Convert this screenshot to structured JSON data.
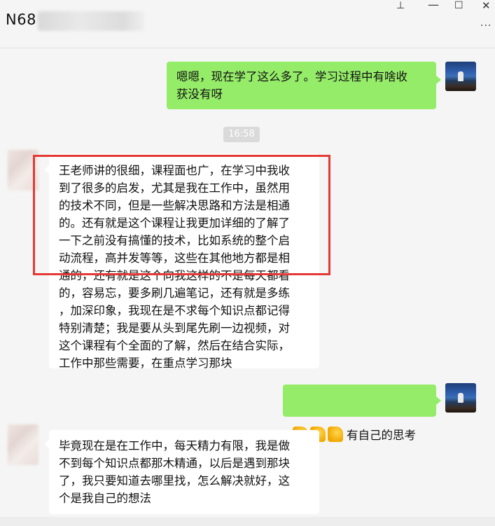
{
  "header": {
    "title": "N68",
    "pin_icon": "pin-icon",
    "minimize_icon": "minimize-icon",
    "maximize_icon": "maximize-icon",
    "close_icon": "close-icon",
    "more_icon": "more-icon"
  },
  "glyphs": {
    "pin": "⊥",
    "minimize": "—",
    "maximize": "☐",
    "close": "✕",
    "more": "···"
  },
  "messages": [
    {
      "sender": "me",
      "text": "嗯嗯，现在学了这么多了。学习过程中有啥收\n获没有呀"
    },
    {
      "sender": "system",
      "text": "16:58"
    },
    {
      "sender": "other",
      "text": "王老师讲的很细，课程面也广，在学习中我收\n到了很多的启发，尤其是我在工作中，虽然用\n的技术不同，但是一些解决思路和方法是相通\n的。还有就是这个课程让我更加详细的了解了\n一下之前没有搞懂的技术，比如系统的整个启\n动流程，高并发等等，这些在其他地方都是相\n通的，还有就是这个向我这样的不是每天都看\n的，容易忘，要多刷几遍笔记，还有就是多练\n，加深印象，我现在是不求每个知识点都记得\n特别清楚；我是要从头到尾先刷一边视频，对\n这个课程有个全面的了解，然后在结合实际，\n工作中那些需要，在重点学习那块"
    },
    {
      "sender": "me",
      "emoji": "thumbs-up-icon",
      "emoji_count": 3,
      "text": "有自己的思考"
    },
    {
      "sender": "other",
      "text": "毕竟现在是在工作中，每天精力有限，我是做\n不到每个知识点都那木精通，以后是遇到那块\n了，我只要知道去哪里找，怎么解决就好，这\n个是我自己的想法"
    }
  ],
  "colors": {
    "my_bubble": "#95ec69",
    "other_bubble": "#ffffff",
    "highlight_border": "#e53935",
    "background": "#f5f5f5"
  }
}
